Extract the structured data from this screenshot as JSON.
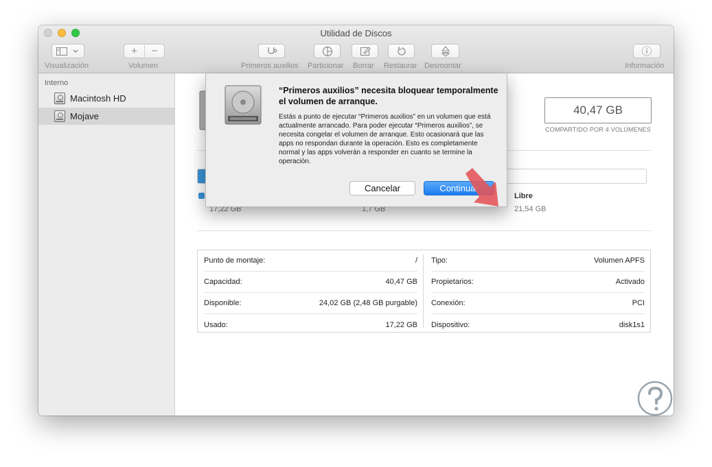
{
  "window": {
    "title": "Utilidad de Discos"
  },
  "toolbar": {
    "view_label": "Visualización",
    "volume_label": "Volumen",
    "first_aid_label": "Primeros auxilios",
    "partition_label": "Particionar",
    "erase_label": "Borrar",
    "restore_label": "Restaurar",
    "unmount_label": "Desmontar",
    "info_label": "Información",
    "add_symbol": "+",
    "remove_symbol": "−",
    "info_symbol": "ⓘ"
  },
  "sidebar": {
    "section": "Interno",
    "items": [
      {
        "label": "Macintosh HD",
        "selected": false
      },
      {
        "label": "Mojave",
        "selected": true
      }
    ]
  },
  "volume": {
    "capacity": "40,47 GB",
    "shared": "COMPARTIDO POR 4 VOLÚMENES",
    "usage_fraction": 0.43,
    "legend": [
      {
        "name": "",
        "value": "17,22 GB",
        "color": "#3a93d8"
      },
      {
        "name": "",
        "value": "1,7 GB",
        "color": "#e0e0e0"
      },
      {
        "name": "Libre",
        "value": "21,54 GB",
        "color": "#ffffff"
      }
    ]
  },
  "info": {
    "left": [
      {
        "label": "Punto de montaje:",
        "value": "/"
      },
      {
        "label": "Capacidad:",
        "value": "40,47 GB"
      },
      {
        "label": "Disponible:",
        "value": "24,02 GB (2,48 GB purgable)"
      },
      {
        "label": "Usado:",
        "value": "17,22 GB"
      }
    ],
    "right": [
      {
        "label": "Tipo:",
        "value": "Volumen APFS"
      },
      {
        "label": "Propietarios:",
        "value": "Activado"
      },
      {
        "label": "Conexión:",
        "value": "PCI"
      },
      {
        "label": "Dispositivo:",
        "value": "disk1s1"
      }
    ]
  },
  "dialog": {
    "title": "“Primeros auxilios” necesita bloquear temporalmente el volumen de arranque.",
    "body": "Estás a punto de ejecutar “Primeros auxilios” en un volumen que está actualmente arrancado. Para poder ejecutar “Primeros auxilios”, se necesita congelar el volumen de arranque. Esto ocasionará que las apps no respondan durante la operación. Esto es completamente normal y las apps volverán a responder en cuanto se termine la operación.",
    "cancel_label": "Cancelar",
    "continue_label": "Continuar"
  },
  "colors": {
    "accent": "#1c7cf0",
    "used": "#3a93d8",
    "arrow": "#e2565b",
    "watermark": "#9aa5ad"
  },
  "icons": [
    "sidebar-view-icon",
    "chevron-down-icon",
    "stethoscope-icon",
    "pie-icon",
    "erase-icon",
    "restore-icon",
    "eject-icon",
    "info-icon",
    "hard-disk-icon",
    "arrow-icon",
    "watermark-logo-icon"
  ]
}
